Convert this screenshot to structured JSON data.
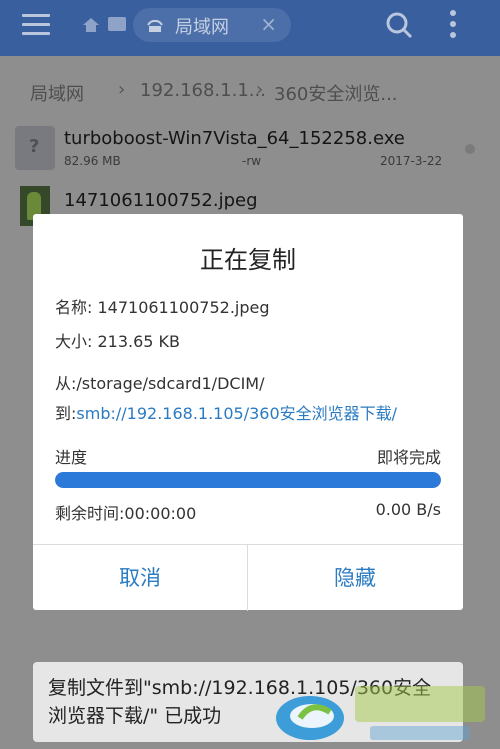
{
  "header": {
    "network_chip_label": "局域网",
    "close_symbol": "×"
  },
  "breadcrumb": [
    "局域网",
    "192.168.1.1...",
    "360安全浏览..."
  ],
  "files": [
    {
      "name": "turboboost-Win7Vista_64_152258.exe",
      "size": "82.96 MB",
      "perm": "-rw",
      "date": "2017-3-22"
    },
    {
      "name": "1471061100752.jpeg"
    }
  ],
  "dialog": {
    "title": "正在复制",
    "name_line": "名称: 1471061100752.jpeg",
    "size_line": "大小: 213.65 KB",
    "from_line": "从:/storage/sdcard1/DCIM/",
    "to_prefix": "到:",
    "to_path": "smb://192.168.1.105/360安全浏览器下载/",
    "progress_label": "进度",
    "progress_status": "即将完成",
    "progress_fraction": 1.0,
    "remaining_time": "剩余时间:00:00:00",
    "speed": "0.00 B/s",
    "cancel_label": "取消",
    "hide_label": "隐藏"
  },
  "toast": {
    "message": "复制文件到\"smb://192.168.1.105/360安全浏览器下载/\" 已成功"
  },
  "colors": {
    "topbar": "#3a5f9e",
    "accent": "#2b7bc2",
    "progress": "#2b79d8"
  }
}
